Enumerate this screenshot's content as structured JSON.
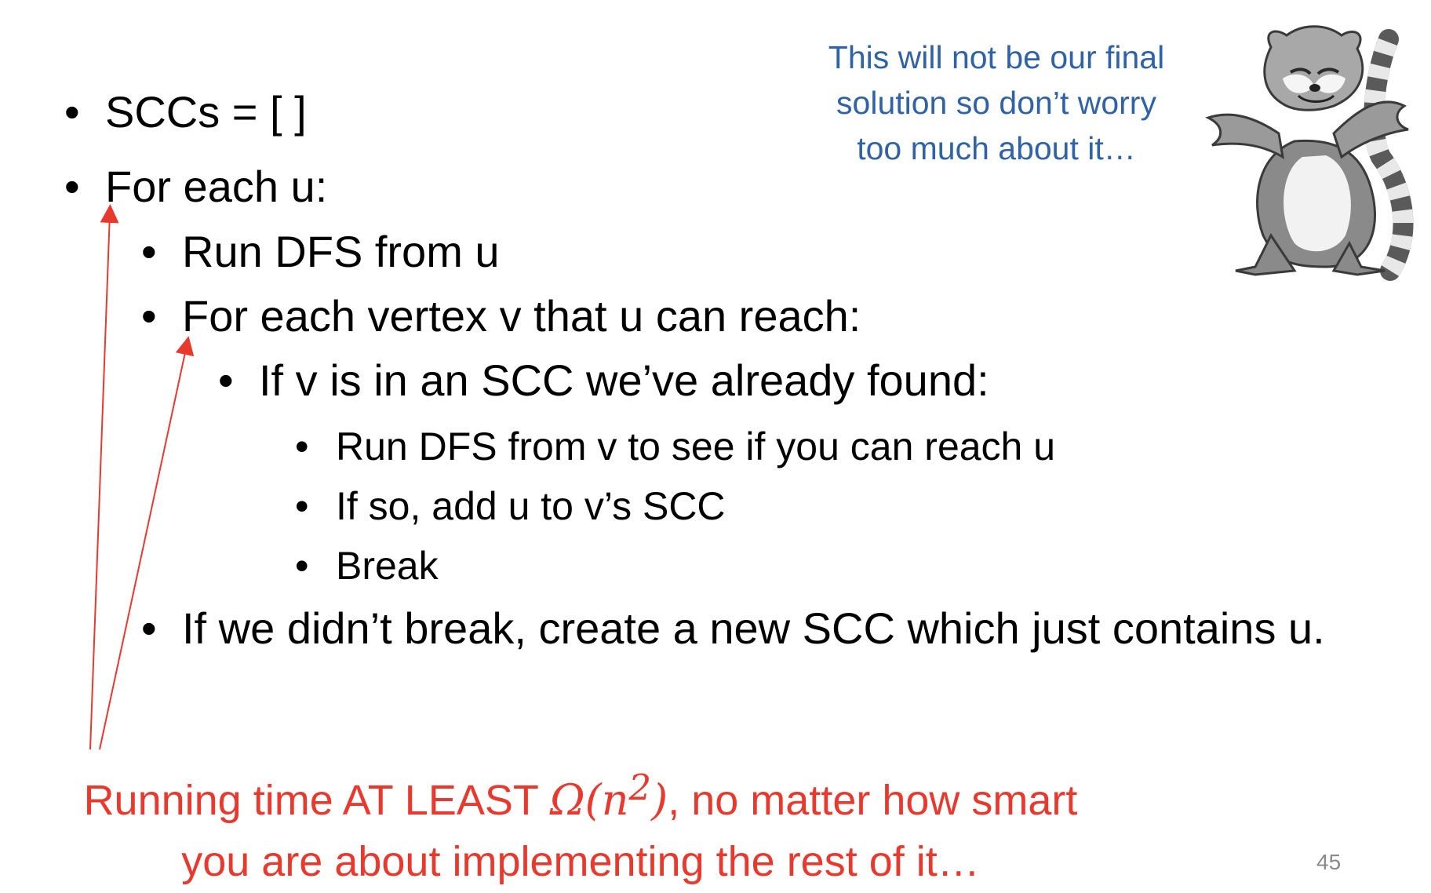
{
  "bullets": [
    "SCCs = [ ]",
    "For each u:",
    "Run DFS from u",
    "For each vertex v that u can reach:",
    "If v is in an SCC we’ve already found:",
    "Run DFS from v to see if you can reach u",
    "If so, add u to v’s SCC",
    "Break",
    "If we didn’t break, create a new SCC which just contains u."
  ],
  "bullet_symbol": "•",
  "note": {
    "line1": "This will not be our final",
    "line2": "solution so don’t worry",
    "line3": "too much about it…"
  },
  "bottom_note": {
    "line1_prefix": "Running time AT LEAST ",
    "omega": "Ω(n",
    "exponent": "2",
    "close": ")",
    "line1_suffix": ", no matter how smart",
    "line2": "you are about implementing the rest of it…"
  },
  "page_number": "45",
  "colors": {
    "note": "#2f63a5",
    "bottom_note": "#e8392e",
    "arrow": "#e8392e",
    "page_number": "#8a8a8a"
  },
  "illustration": "lemur-shrug-cartoon"
}
